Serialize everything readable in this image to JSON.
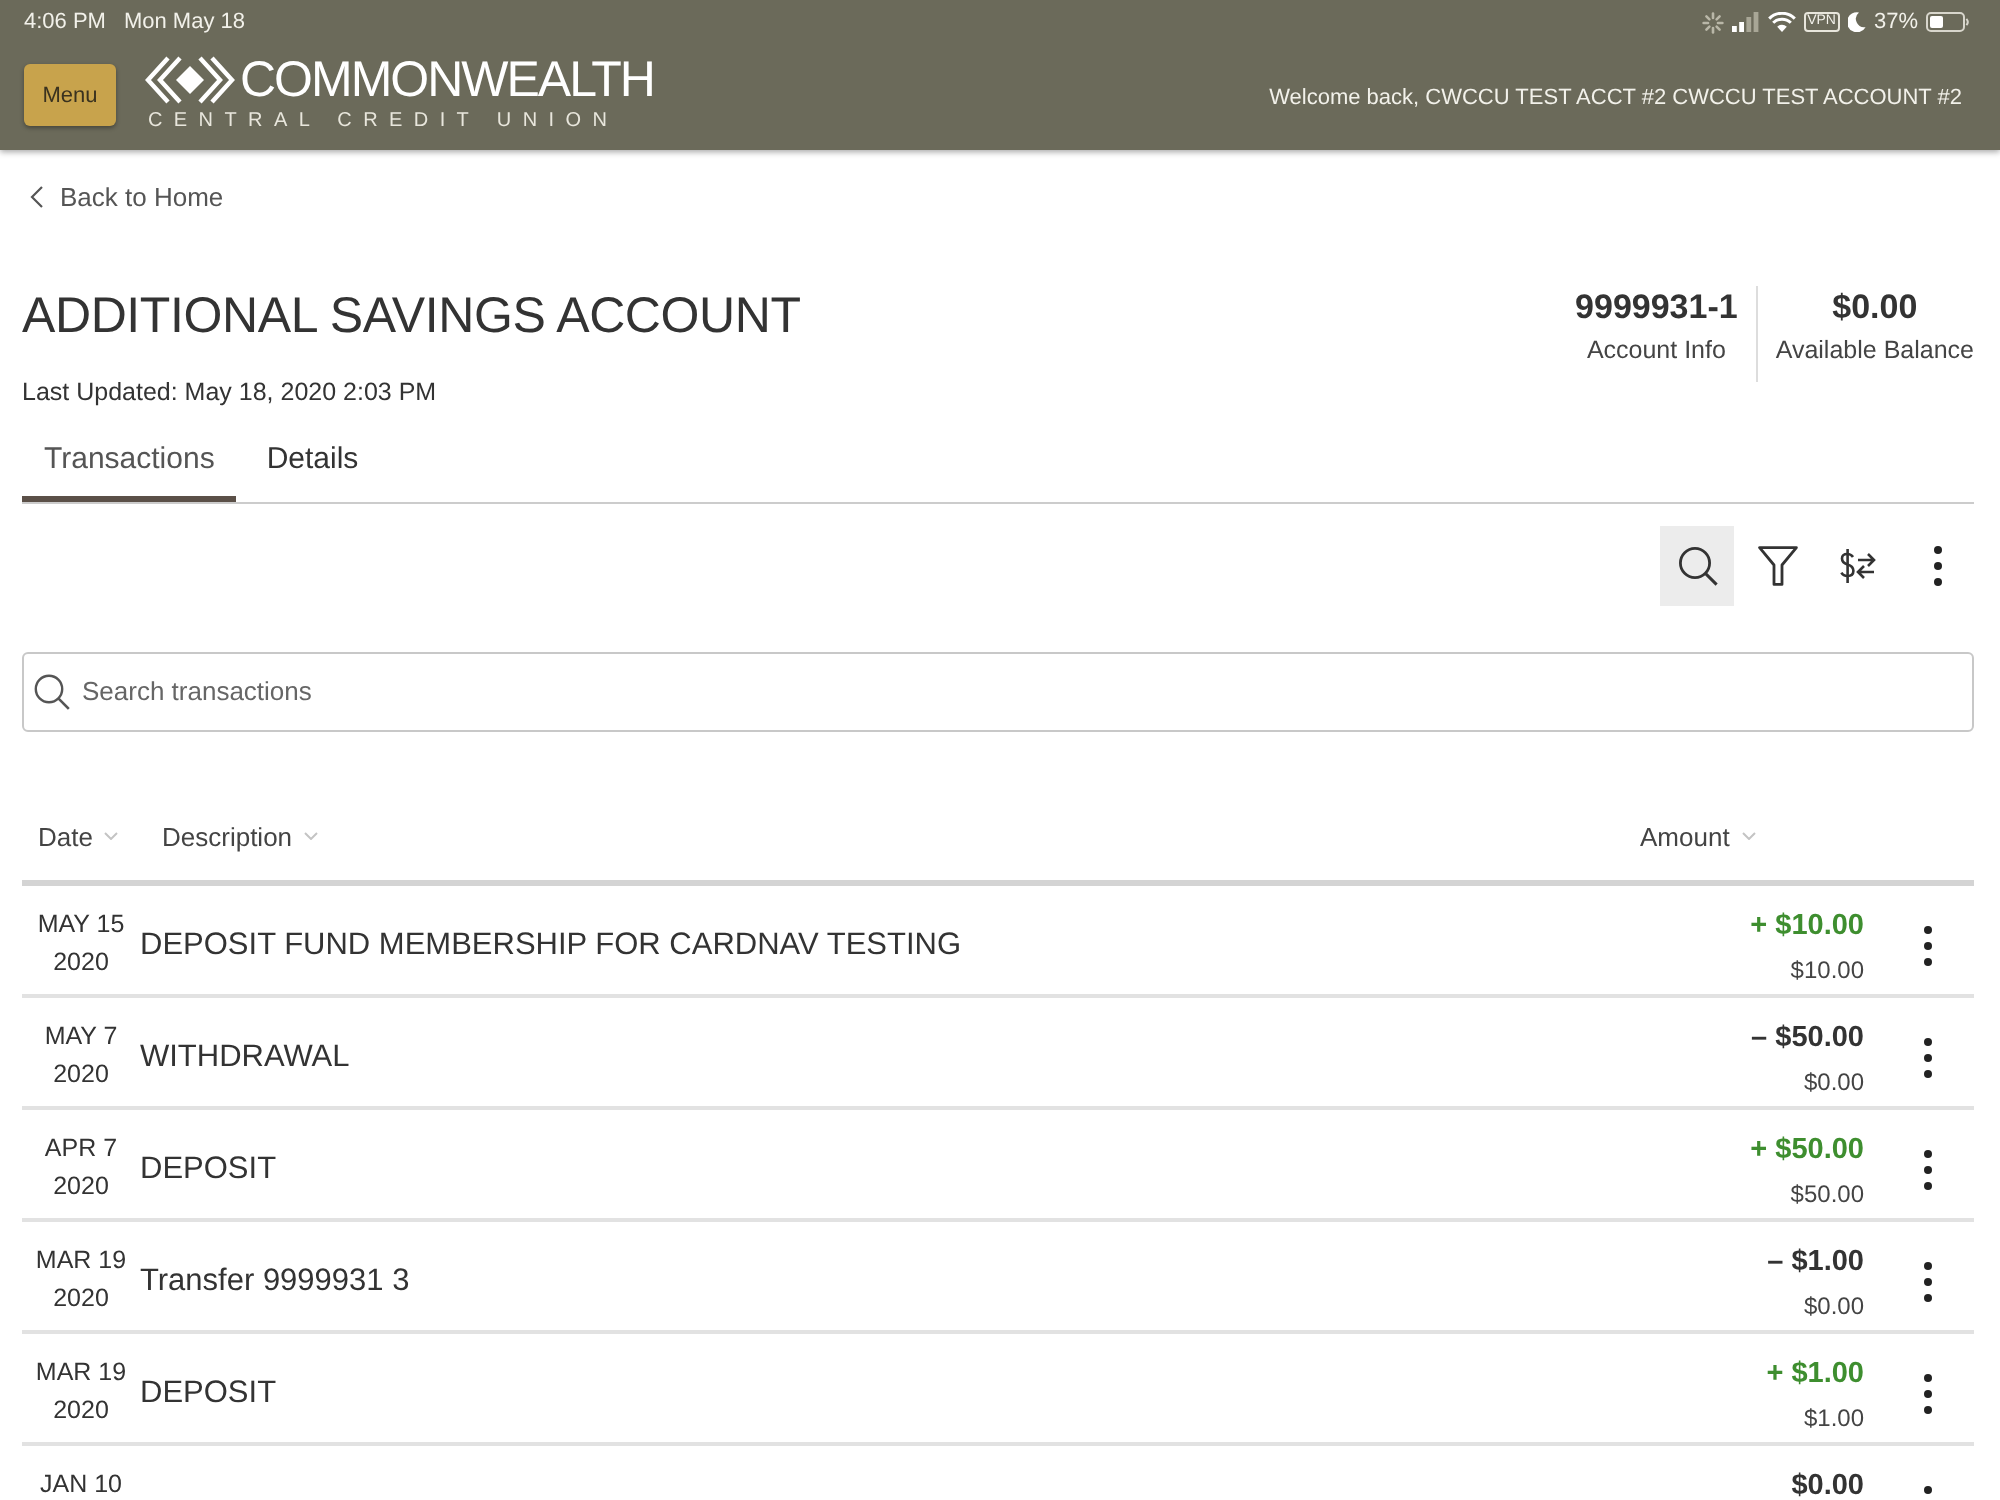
{
  "status_bar": {
    "time": "4:06 PM",
    "date": "Mon May 18",
    "vpn": "VPN",
    "battery": "37%"
  },
  "header": {
    "menu_button": "Menu",
    "logo": {
      "name": "COMMONWEALTH",
      "tagline": "CENTRAL CREDIT UNION"
    },
    "welcome": "Welcome back, CWCCU TEST ACCT #2 CWCCU TEST ACCOUNT #2"
  },
  "back_link": "Back to Home",
  "account": {
    "title": "ADDITIONAL SAVINGS ACCOUNT",
    "last_updated": "Last Updated: May 18, 2020 2:03 PM",
    "number": "9999931-1",
    "number_label": "Account Info",
    "balance": "$0.00",
    "balance_label": "Available Balance"
  },
  "tabs": [
    {
      "label": "Transactions",
      "selected": true
    },
    {
      "label": "Details",
      "selected": false
    }
  ],
  "toolbar": [
    {
      "kind": "search",
      "selected": true
    },
    {
      "kind": "filter",
      "selected": false
    },
    {
      "kind": "transfer",
      "selected": false
    },
    {
      "kind": "more",
      "selected": false
    }
  ],
  "search": {
    "placeholder": "Search transactions"
  },
  "table": {
    "columns": [
      {
        "label": "Date"
      },
      {
        "label": "Description"
      },
      {
        "label": "Amount"
      }
    ],
    "rows": [
      {
        "date": "MAY 15",
        "year": "2020",
        "description": "DEPOSIT FUND MEMBERSHIP FOR CARDNAV TESTING",
        "kind": "credit",
        "amount": "+ $10.00",
        "balance": "$10.00"
      },
      {
        "date": "MAY 7",
        "year": "2020",
        "description": "WITHDRAWAL",
        "kind": "debit",
        "amount": "– $50.00",
        "balance": "$0.00"
      },
      {
        "date": "APR 7",
        "year": "2020",
        "description": "DEPOSIT",
        "kind": "credit",
        "amount": "+ $50.00",
        "balance": "$50.00"
      },
      {
        "date": "MAR 19",
        "year": "2020",
        "description": "Transfer 9999931 3",
        "kind": "debit",
        "amount": "– $1.00",
        "balance": "$0.00"
      },
      {
        "date": "MAR 19",
        "year": "2020",
        "description": "DEPOSIT",
        "kind": "credit",
        "amount": "+ $1.00",
        "balance": "$1.00"
      },
      {
        "date": "JAN 10",
        "kind": "debit",
        "amount": "$0.00"
      }
    ]
  }
}
